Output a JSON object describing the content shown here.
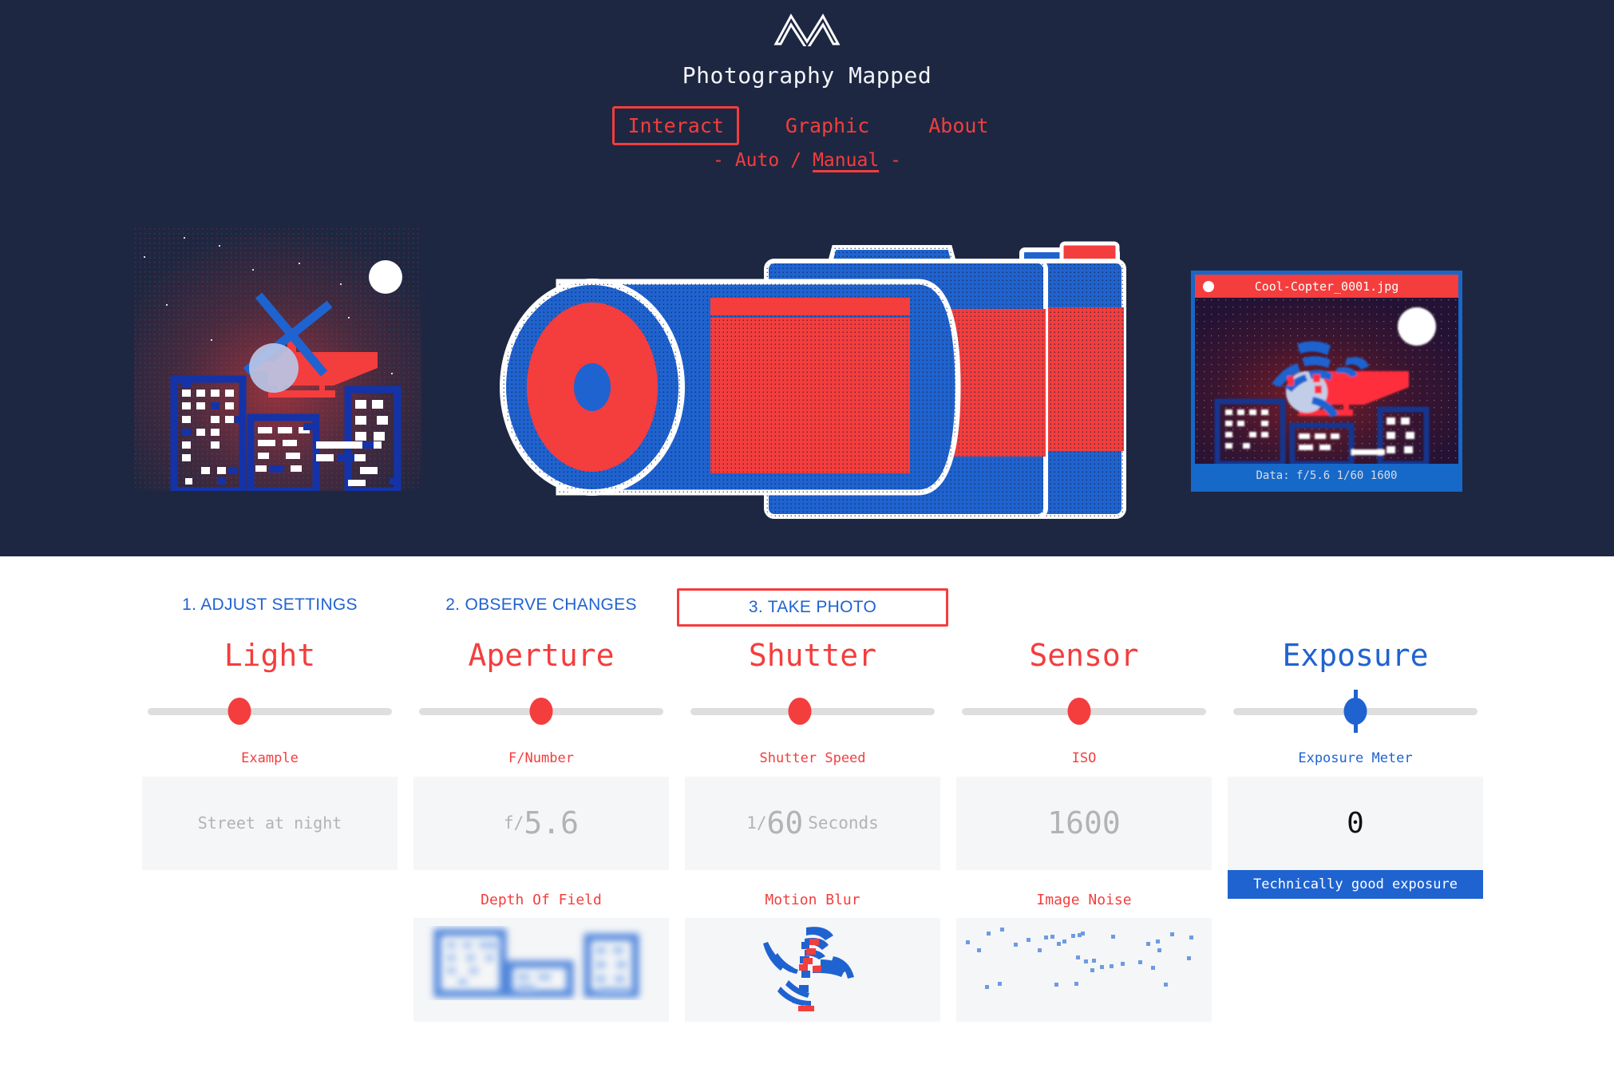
{
  "colors": {
    "hero_bg": "#1e2741",
    "red": "#f43d3d",
    "blue": "#1f63d0",
    "photo_blue": "#1668c9",
    "white": "#ffffff",
    "readout_bg": "#f5f6f7",
    "track": "#dedede",
    "muted_text": "#b3b3b3"
  },
  "header": {
    "logo_icon": "mountain-m-logo-icon",
    "title": "Photography Mapped",
    "nav": [
      {
        "label": "Interact",
        "active": true
      },
      {
        "label": "Graphic",
        "active": false
      },
      {
        "label": "About",
        "active": false
      }
    ],
    "mode": {
      "left_dash": "-",
      "right_dash": "-",
      "separator": "/",
      "options": [
        {
          "label": "Auto",
          "active": false
        },
        {
          "label": "Manual",
          "active": true
        }
      ]
    }
  },
  "hero": {
    "scene_alt": "Street at night with helicopter and city skyline",
    "camera_alt": "Stippled camera illustration",
    "photo_preview": {
      "dot_icon": "record-dot-icon",
      "filename": "Cool-Copter_0001.jpg",
      "data_line": "Data: f/5.6 1/60 1600"
    }
  },
  "steps": [
    {
      "label": "1. ADJUST SETTINGS",
      "boxed": false
    },
    {
      "label": "2. OBSERVE CHANGES",
      "boxed": false
    },
    {
      "label": "3. TAKE PHOTO",
      "boxed": true
    }
  ],
  "controls": [
    {
      "key": "light",
      "title": "Light",
      "accent": "#f43d3d",
      "slider_percent": 33,
      "sub_label": "Example",
      "readout": {
        "style": "small",
        "text": "Street at night"
      },
      "effect": null
    },
    {
      "key": "aperture",
      "title": "Aperture",
      "accent": "#f43d3d",
      "slider_percent": 50,
      "sub_label": "F/Number",
      "readout": {
        "style": "split",
        "prefix": "f/",
        "value": "5.6",
        "suffix": ""
      },
      "effect": {
        "label": "Depth Of Field",
        "icon": "blurred-cityscape-icon"
      }
    },
    {
      "key": "shutter",
      "title": "Shutter",
      "accent": "#f43d3d",
      "slider_percent": 45,
      "sub_label": "Shutter Speed",
      "readout": {
        "style": "split",
        "prefix": "1/",
        "value": "60",
        "suffix": "Seconds"
      },
      "effect": {
        "label": "Motion Blur",
        "icon": "spinning-rotor-icon"
      }
    },
    {
      "key": "sensor",
      "title": "Sensor",
      "accent": "#f43d3d",
      "slider_percent": 48,
      "sub_label": "ISO",
      "readout": {
        "style": "split",
        "prefix": "",
        "value": "1600",
        "suffix": ""
      },
      "effect": {
        "label": "Image Noise",
        "icon": "noise-speckle-icon"
      }
    },
    {
      "key": "exposure",
      "title": "Exposure",
      "accent": "#1f63d0",
      "slider_percent": 50,
      "sub_label": "Exposure Meter",
      "readout": {
        "style": "exposure",
        "value": "0"
      },
      "badge": "Technically good exposure",
      "effect": null
    }
  ]
}
